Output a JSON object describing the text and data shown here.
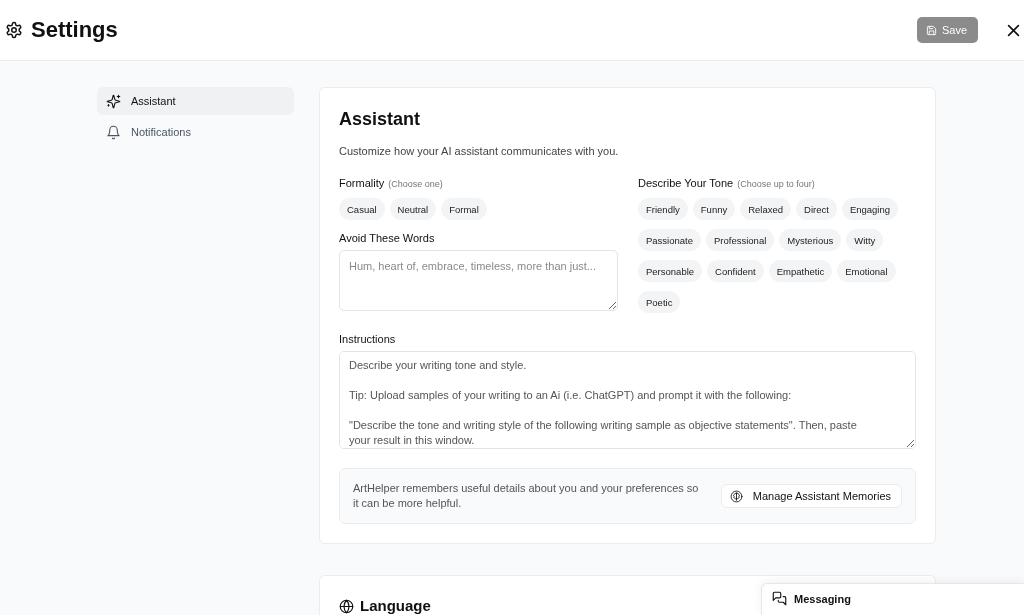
{
  "header": {
    "title": "Settings",
    "save_button": {
      "label": "Save",
      "disabled": true
    }
  },
  "sidebar": {
    "items": [
      {
        "label": "Assistant",
        "kind": "sparkles",
        "selected": true
      },
      {
        "label": "Notifications",
        "kind": "bell",
        "selected": false
      }
    ]
  },
  "assistant_card": {
    "title": "Assistant",
    "description": "Customize how your AI assistant communicates with you.",
    "formality": {
      "label": "Formality",
      "hint": "(Choose one)",
      "options": [
        {
          "label": "Casual",
          "selected": false
        },
        {
          "label": "Neutral",
          "selected": false
        },
        {
          "label": "Formal",
          "selected": false
        }
      ]
    },
    "avoid_words": {
      "label": "Avoid These Words",
      "placeholder": "Hum, heart of, embrace, timeless, more than just..."
    },
    "tone": {
      "label": "Describe Your Tone",
      "hint": "(Choose up to four)",
      "options": [
        {
          "label": "Friendly",
          "selected": false
        },
        {
          "label": "Funny",
          "selected": false
        },
        {
          "label": "Relaxed",
          "selected": false
        },
        {
          "label": "Direct",
          "selected": false
        },
        {
          "label": "Engaging",
          "selected": false
        },
        {
          "label": "Passionate",
          "selected": false
        },
        {
          "label": "Professional",
          "selected": false
        },
        {
          "label": "Mysterious",
          "selected": false
        },
        {
          "label": "Witty",
          "selected": false
        },
        {
          "label": "Personable",
          "selected": false
        },
        {
          "label": "Confident",
          "selected": false
        },
        {
          "label": "Empathetic",
          "selected": false
        },
        {
          "label": "Emotional",
          "selected": false
        },
        {
          "label": "Poetic",
          "selected": false
        }
      ]
    },
    "instructions": {
      "label": "Instructions",
      "value": "Describe your writing tone and style.\n\nTip: Upload samples of your writing to an Ai (i.e. ChatGPT) and prompt it with the following:\n\n\"Describe the tone and writing style of the following writing sample as objective statements\". Then, paste your result in this window."
    },
    "memories": {
      "text": "ArtHelper remembers useful details about you and your preferences so it can be more helpful.",
      "button": "Manage Assistant Memories"
    }
  },
  "language_card": {
    "title": "Language"
  },
  "messaging_panel": {
    "label": "Messaging"
  }
}
